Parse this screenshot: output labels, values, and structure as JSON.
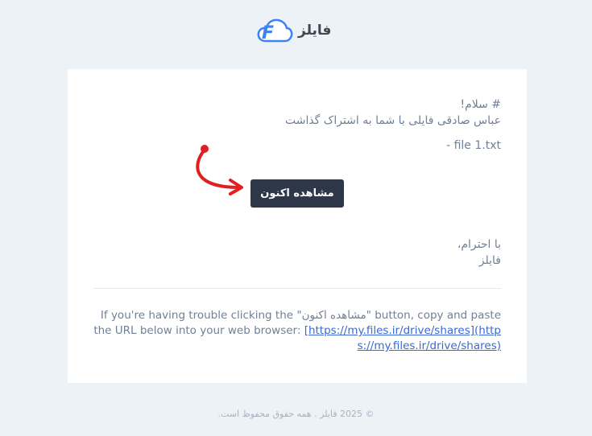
{
  "header": {
    "brand_name": "فایلز",
    "logo_letter": "F"
  },
  "email": {
    "greeting_line1": "# سلام!",
    "greeting_line2": "عباس صادقی فایلی با شما به اشتراک گذاشت",
    "file_item": "- file 1.txt",
    "action_button_label": "مشاهده اکنون",
    "signoff_line1": "با احترام،",
    "signoff_line2": "فایلز",
    "subcopy_text": "If you're having trouble clicking the \"مشاهده اکنون\" button, copy and paste the URL below into your web browser: ",
    "subcopy_link": "[https://my.files.ir/drive/shares](https://my.files.ir/drive/shares)"
  },
  "footer": {
    "copyright": "© 2025 فایلز . همه حقوق محفوظ است."
  },
  "colors": {
    "background": "#edf2f7",
    "card": "#ffffff",
    "button": "#2d3748",
    "arrow": "#e02020",
    "link": "#3869d4",
    "logo_blue": "#3b82f6"
  }
}
